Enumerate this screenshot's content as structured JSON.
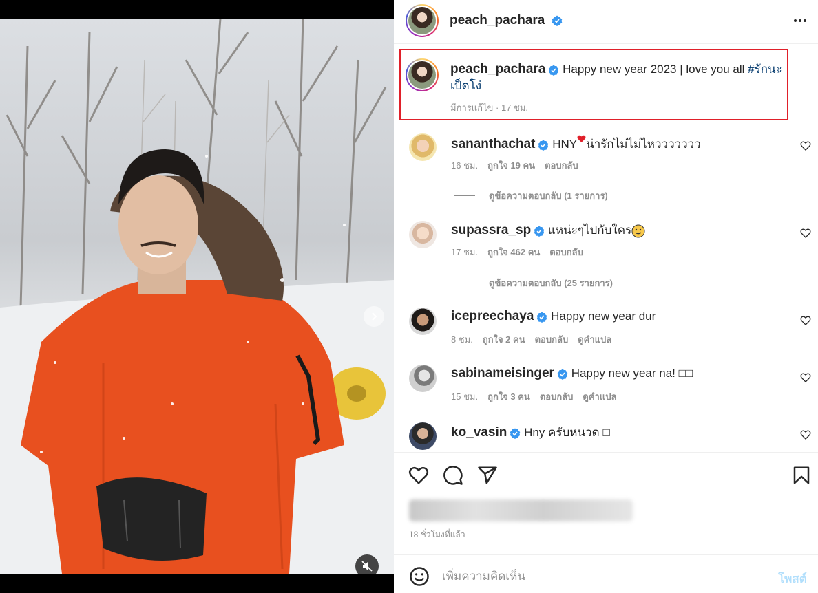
{
  "post": {
    "author": "peach_pachara",
    "caption": "Happy new year 2023 | love you all",
    "hashtag_line1": "#รักนะ",
    "hashtag_line2": "เป็ดโง่",
    "edited_label": "มีการแก้ไข",
    "time": "17 ชม."
  },
  "comments": [
    {
      "user": "sananthachat",
      "text": "HNY",
      "text2": "น่ารักไม่ไม่ไหววววววว",
      "time": "16 ชม.",
      "likes": "ถูกใจ 19 คน",
      "reply": "ตอบกลับ",
      "view_replies": "ดูข้อความตอบกลับ (1 รายการ)"
    },
    {
      "user": "supassra_sp",
      "text": "แหน่ะๆไปกับใคร",
      "time": "17 ชม.",
      "likes": "ถูกใจ 462 คน",
      "reply": "ตอบกลับ",
      "view_replies": "ดูข้อความตอบกลับ (25 รายการ)"
    },
    {
      "user": "icepreechaya",
      "text": "Happy new year dur",
      "time": "8 ชม.",
      "likes": "ถูกใจ 2 คน",
      "reply": "ตอบกลับ",
      "translate": "ดูคำแปล"
    },
    {
      "user": "sabinameisinger",
      "text": "Happy new year na! □□",
      "time": "15 ชม.",
      "likes": "ถูกใจ 3 คน",
      "reply": "ตอบกลับ",
      "translate": "ดูคำแปล"
    },
    {
      "user": "ko_vasin",
      "text": "Hny ครับหนวด □"
    }
  ],
  "footer": {
    "time_ago": "18 ชั่วโมงที่แล้ว",
    "comment_placeholder": "เพิ่มความคิดเห็น",
    "post_label": "โพสต์"
  },
  "media": {
    "slide_count": 7,
    "active_slide": 1,
    "jacket_color": "#e8501f"
  },
  "icons": [
    "verified-icon",
    "more-icon",
    "heart-icon",
    "comment-icon",
    "share-icon",
    "bookmark-icon",
    "emoji-icon",
    "mute-icon",
    "chevron-right-icon"
  ],
  "colors": {
    "verified": "#3897f0",
    "hashtag": "#00376b",
    "highlight_box": "#e0202a",
    "post_button": "#b2dffc"
  }
}
